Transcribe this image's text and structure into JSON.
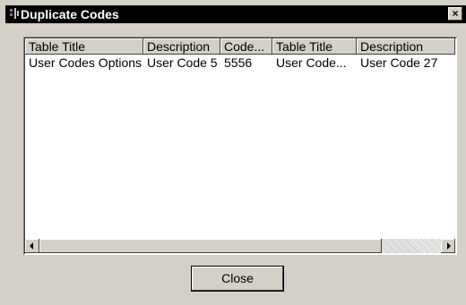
{
  "window": {
    "title": "Duplicate Codes",
    "icon": "app-icon",
    "close_glyph": "×"
  },
  "table": {
    "columns": [
      "Table Title",
      "Description",
      "Code...",
      "Table Title",
      "Description"
    ],
    "rows": [
      [
        "User Codes Options",
        "User Code 5",
        "5556",
        "User Code...",
        "User Code 27"
      ]
    ]
  },
  "buttons": {
    "close_label": "Close"
  },
  "colors": {
    "titlebar": "#000000",
    "face": "#d4d0c8"
  }
}
